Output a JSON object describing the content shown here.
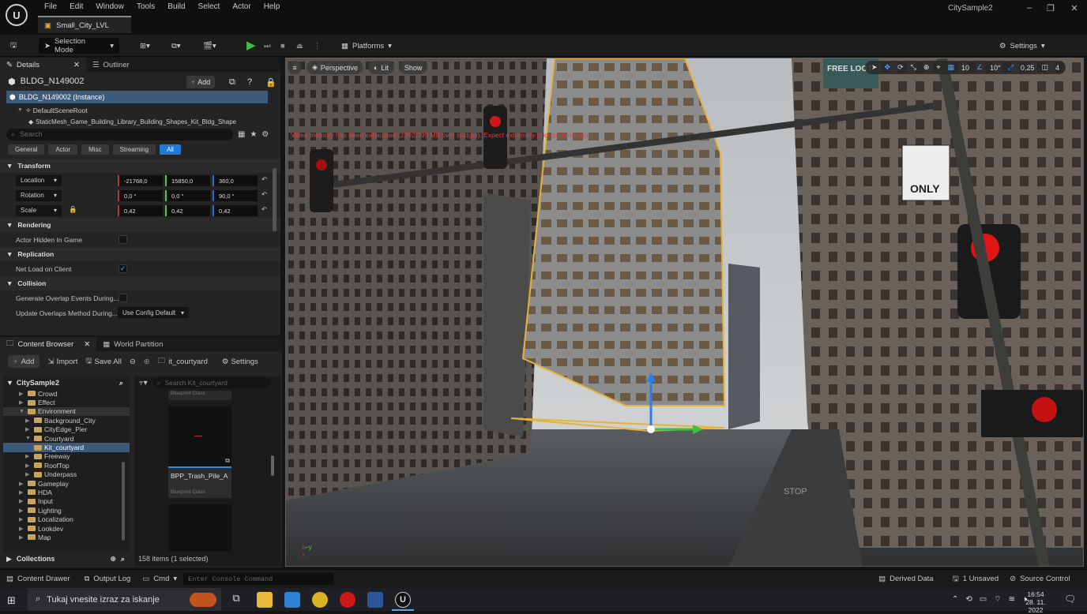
{
  "menu": [
    "File",
    "Edit",
    "Window",
    "Tools",
    "Build",
    "Select",
    "Actor",
    "Help"
  ],
  "level_tab": "Small_City_LVL",
  "project_name": "CitySample2",
  "toolbar": {
    "select_mode": "Selection Mode",
    "platforms": "Platforms",
    "settings": "Settings"
  },
  "details": {
    "tab_details": "Details",
    "tab_outliner": "Outliner",
    "actor_name": "BLDG_N149002",
    "add_label": "Add",
    "tree": [
      "BLDG_N149002 (Instance)",
      "DefaultSceneRoot",
      "StaticMesh_Game_Building_Library_Building_Shapes_Kit_Bldg_Shape"
    ],
    "search_placeholder": "Search",
    "filters": [
      "General",
      "Actor",
      "Misc",
      "Streaming",
      "All"
    ],
    "sections": {
      "transform": "Transform",
      "rendering": "Rendering",
      "replication": "Replication",
      "collision": "Collision"
    },
    "location": {
      "label": "Location",
      "x": "-21768,0",
      "y": "15850,0",
      "z": "360,0"
    },
    "rotation": {
      "label": "Rotation",
      "x": "0,0 °",
      "y": "0,0 °",
      "z": "90,0 °"
    },
    "scale": {
      "label": "Scale",
      "x": "0,42",
      "y": "0,42",
      "z": "0,42"
    },
    "actor_hidden": "Actor Hidden In Game",
    "net_load": "Net Load on Client",
    "gen_overlap": "Generate Overlap Events During...",
    "update_overlap": "Update Overlaps Method During...",
    "update_overlap_value": "Use Config Default"
  },
  "content_browser": {
    "tab_cb": "Content Browser",
    "tab_wp": "World Partition",
    "add": "Add",
    "import": "Import",
    "save_all": "Save All",
    "path": "it_courtyard",
    "settings": "Settings",
    "root": "CitySample2",
    "folders": [
      "Crowd",
      "Effect",
      "Environment",
      "Background_City",
      "CityEdge_Pier",
      "Courtyard",
      "Kit_courtyard",
      "Freeway",
      "RoofTop",
      "Underpass",
      "Gameplay",
      "HDA",
      "Input",
      "Lighting",
      "Localization",
      "Lookdev",
      "Map"
    ],
    "search_placeholder": "Search Kit_courtyard",
    "asset_class_top": "Blueprint Class",
    "asset_name": "BPP_Trash_Pile_A",
    "asset_class": "Blueprint Class",
    "collections": "Collections",
    "item_count": "158 items (1 selected)"
  },
  "viewport": {
    "perspective": "Perspective",
    "lit": "Lit",
    "show": "Show",
    "warning": "Video memory has been exhausted (2392.399 MB over budget). Expect extremely poor performance.",
    "grid": "10",
    "angle": "10°",
    "scale_snap": "0,25",
    "camera_speed": "4",
    "sign_only": "ONLY",
    "sign_stop": "STOP",
    "sign_free": "FREE LOOT"
  },
  "bottombar": {
    "content_drawer": "Content Drawer",
    "output_log": "Output Log",
    "cmd": "Cmd",
    "console_placeholder": "Enter Console Command",
    "derived_data": "Derived Data",
    "unsaved": "1 Unsaved",
    "source_control": "Source Control"
  },
  "taskbar": {
    "search": "Tukaj vnesite izraz za iskanje",
    "time": "16:54",
    "date": "28. 11. 2022"
  }
}
